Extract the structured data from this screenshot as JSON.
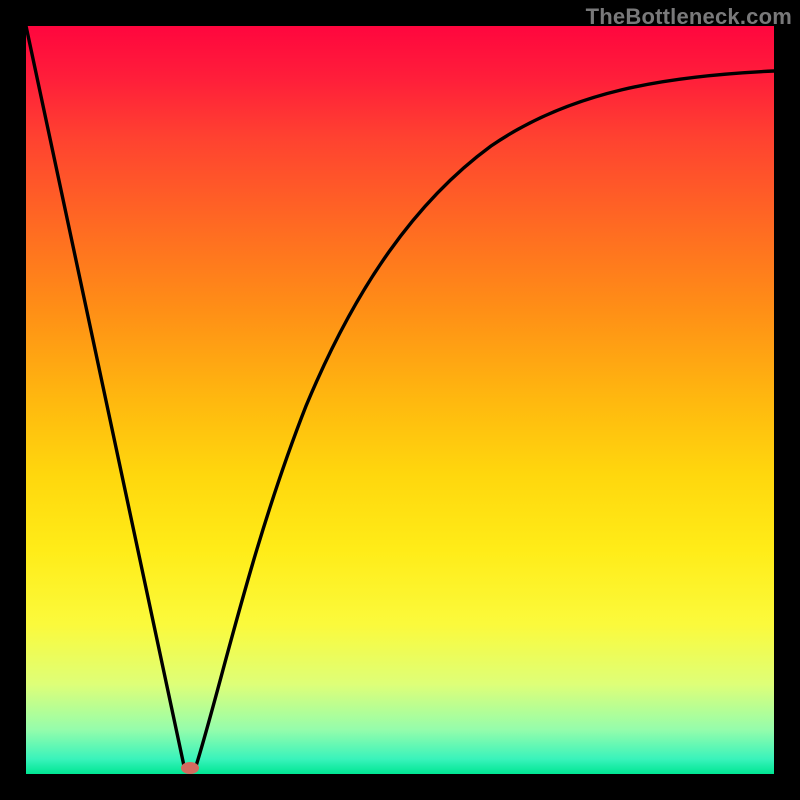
{
  "watermark": "TheBottleneck.com",
  "colors": {
    "gradient_top": "#ff063e",
    "gradient_mid": "#ffd70d",
    "gradient_bottom": "#00e693",
    "curve": "#000000",
    "dot": "#d46a5f",
    "frame": "#000000"
  },
  "chart_data": {
    "type": "line",
    "title": "",
    "xlabel": "",
    "ylabel": "",
    "xlim": [
      0,
      100
    ],
    "ylim": [
      0,
      100
    ],
    "series": [
      {
        "name": "bottleneck-curve",
        "x": [
          0,
          5,
          10,
          15,
          20,
          22,
          25,
          30,
          35,
          40,
          45,
          50,
          55,
          60,
          65,
          70,
          75,
          80,
          85,
          90,
          95,
          100
        ],
        "y": [
          100,
          77,
          53,
          30,
          7,
          1,
          12,
          30,
          45,
          57,
          66,
          73,
          78,
          82,
          85,
          88,
          90,
          91,
          92,
          93,
          93,
          94
        ]
      }
    ],
    "annotations": [
      {
        "name": "minimum-dot",
        "x": 22,
        "y": 1
      }
    ],
    "legend": false,
    "grid": false
  }
}
